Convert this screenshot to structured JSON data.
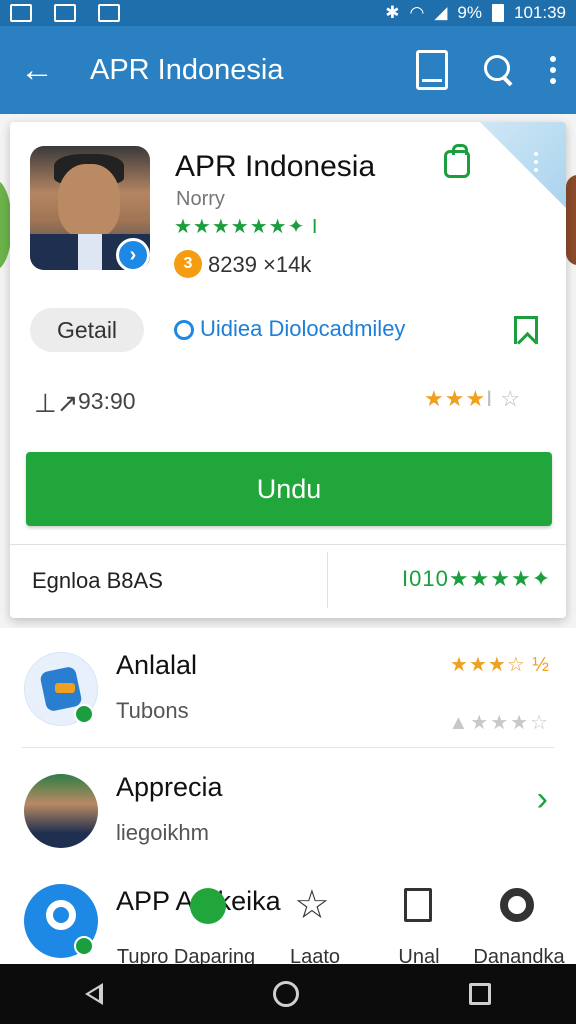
{
  "status_bar": {
    "battery": "9%",
    "time": "101:39"
  },
  "app_bar": {
    "back_glyph": "←",
    "title": "APR Indonesia"
  },
  "card": {
    "title": "APR Indonesia",
    "subtitle": "Norry",
    "rating_stars": "★★★★★★✦ I",
    "download_icon": "3",
    "downloads": "8239 ×14k",
    "detail_button": "Getail",
    "developer_link": "Uidiea Diolocadmiley",
    "stat_icon": "⊥↗",
    "stat_value": "93:90",
    "stat_stars": "★★★",
    "stat_stars_tail": "I ☆",
    "install_button": "Undu",
    "footer_left": "Egnloa B8AS",
    "footer_right": "I010★★★★✦"
  },
  "list": [
    {
      "title": "Anlalal",
      "subtitle": "Tubons",
      "rating_top": "★★★☆ ½",
      "rating_bottom": "▲★★★☆"
    },
    {
      "title": "Apprecia",
      "subtitle": "liegoikhm",
      "chevron": "›"
    },
    {
      "title": "APP Arekeika",
      "subtitle": ""
    }
  ],
  "bottom_nav": [
    {
      "label": "Tupro Daparing",
      "icon": "chat-icon"
    },
    {
      "label": "Laato",
      "icon": "star-icon"
    },
    {
      "label": "Unal",
      "icon": "bookmark-icon"
    },
    {
      "label": "Danandka",
      "icon": "search-icon"
    }
  ],
  "colors": {
    "primary": "#2a80c1",
    "accent_green": "#21a63b",
    "star_orange": "#f0a020"
  }
}
